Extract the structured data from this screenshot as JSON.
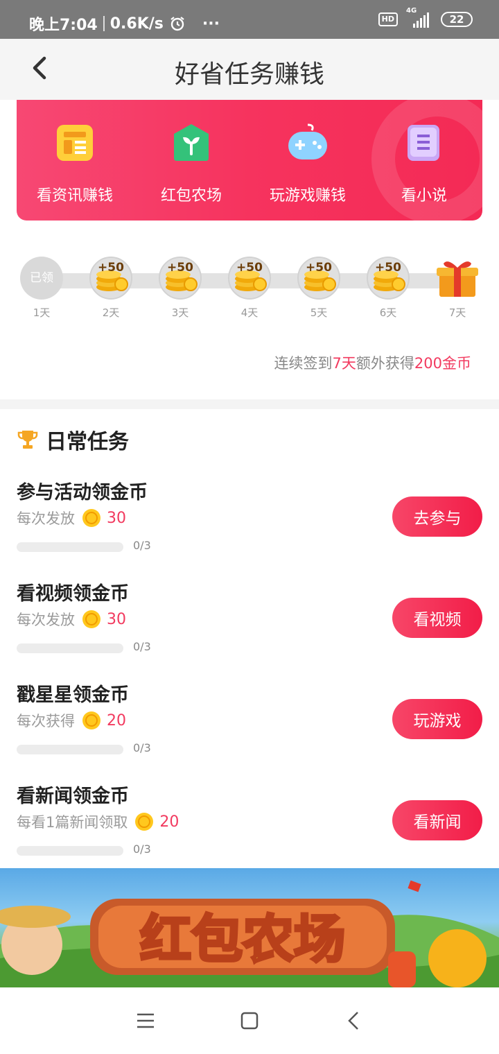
{
  "status_bar": {
    "time": "晚上7:04",
    "speed": "0.6K/s",
    "more": "···",
    "hd": "HD",
    "network": "4G",
    "battery": "22"
  },
  "header": {
    "title": "好省任务赚钱"
  },
  "entries": [
    {
      "label": "看资讯赚钱",
      "icon": "news-icon"
    },
    {
      "label": "红包农场",
      "icon": "farm-sprout-icon"
    },
    {
      "label": "玩游戏赚钱",
      "icon": "gamepad-icon"
    },
    {
      "label": "看小说",
      "icon": "book-icon"
    }
  ],
  "checkin": {
    "days": [
      {
        "label": "1天",
        "state": "done",
        "text": "已领"
      },
      {
        "label": "2天",
        "state": "coin",
        "bonus": "+50"
      },
      {
        "label": "3天",
        "state": "coin",
        "bonus": "+50"
      },
      {
        "label": "4天",
        "state": "coin",
        "bonus": "+50"
      },
      {
        "label": "5天",
        "state": "coin",
        "bonus": "+50"
      },
      {
        "label": "6天",
        "state": "coin",
        "bonus": "+50"
      },
      {
        "label": "7天",
        "state": "gift"
      }
    ],
    "note_prefix": "连续签到",
    "note_days": "7天",
    "note_middle": "额外获得",
    "note_reward": "200金币"
  },
  "daily": {
    "title": "日常任务",
    "tasks": [
      {
        "name": "参与活动领金币",
        "desc": "每次发放",
        "amount": "30",
        "progress": "0/3",
        "button": "去参与"
      },
      {
        "name": "看视频领金币",
        "desc": "每次发放",
        "amount": "30",
        "progress": "0/3",
        "button": "看视频"
      },
      {
        "name": "戳星星领金币",
        "desc": "每次获得",
        "amount": "20",
        "progress": "0/3",
        "button": "玩游戏"
      },
      {
        "name": "看新闻领金币",
        "desc": "每看1篇新闻领取",
        "amount": "20",
        "progress": "0/3",
        "button": "看新闻"
      }
    ]
  },
  "promo": {
    "title": "红包农场"
  },
  "colors": {
    "accent": "#f23a5f",
    "banner": "#f6335e",
    "gold": "#f5b800"
  }
}
